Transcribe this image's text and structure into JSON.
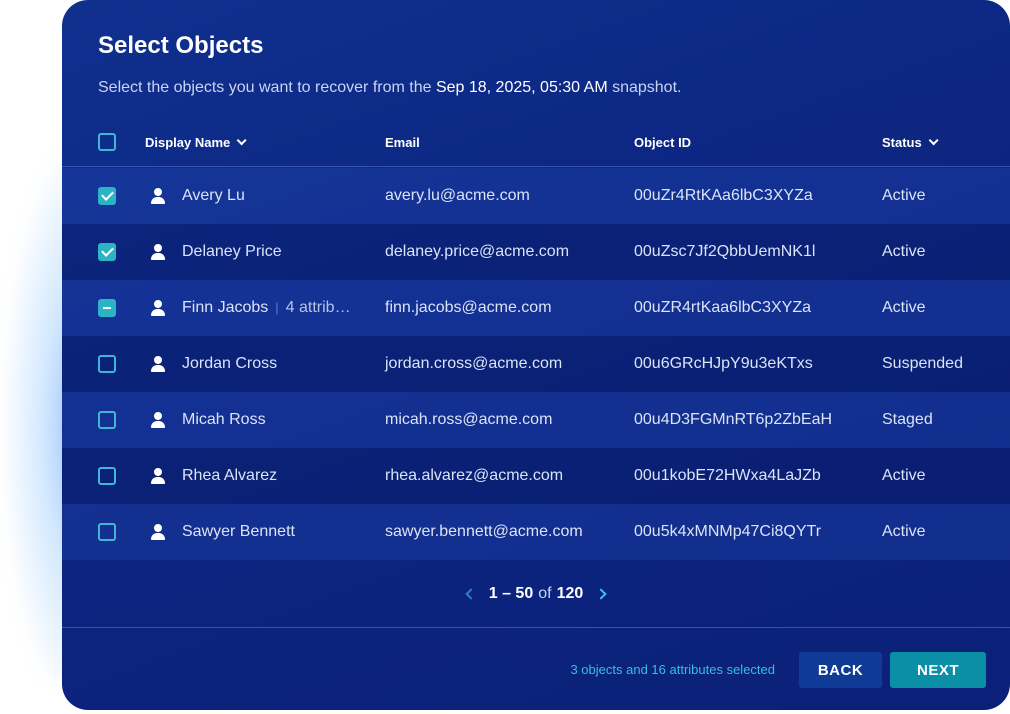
{
  "dialog": {
    "title": "Select Objects",
    "subtitle_prefix": "Select the objects you want to recover from the ",
    "subtitle_date": "Sep 18, 2025, 05:30 AM",
    "subtitle_suffix": " snapshot."
  },
  "columns": {
    "display_name": "Display Name",
    "email": "Email",
    "object_id": "Object ID",
    "status": "Status"
  },
  "rows": [
    {
      "name": "Avery Lu",
      "attrs": "",
      "email": "avery.lu@acme.com",
      "object_id": "00uZr4RtKAa6lbC3XYZa",
      "status": "Active",
      "selection": "checked"
    },
    {
      "name": "Delaney Price",
      "attrs": "",
      "email": "delaney.price@acme.com",
      "object_id": "00uZsc7Jf2QbbUemNK1l",
      "status": "Active",
      "selection": "checked"
    },
    {
      "name": "Finn Jacobs",
      "attrs": "4 attrib…",
      "email": "finn.jacobs@acme.com",
      "object_id": "00uZR4rtKaa6lbC3XYZa",
      "status": "Active",
      "selection": "partial"
    },
    {
      "name": "Jordan Cross",
      "attrs": "",
      "email": "jordan.cross@acme.com",
      "object_id": "00u6GRcHJpY9u3eKTxs",
      "status": "Suspended",
      "selection": "none"
    },
    {
      "name": "Micah Ross",
      "attrs": "",
      "email": "micah.ross@acme.com",
      "object_id": "00u4D3FGMnRT6p2ZbEaH",
      "status": "Staged",
      "selection": "none"
    },
    {
      "name": "Rhea Alvarez",
      "attrs": "",
      "email": "rhea.alvarez@acme.com",
      "object_id": "00u1kobE72HWxa4LaJZb",
      "status": "Active",
      "selection": "none"
    },
    {
      "name": "Sawyer Bennett",
      "attrs": "",
      "email": "sawyer.bennett@acme.com",
      "object_id": "00u5k4xMNMp47Ci8QYTr",
      "status": "Active",
      "selection": "none"
    }
  ],
  "pagination": {
    "range": "1 – 50",
    "of": "of",
    "total": "120"
  },
  "footer": {
    "selection_summary": "3 objects and 16 attributes selected",
    "back_label": "BACK",
    "next_label": "NEXT"
  },
  "colors": {
    "accent": "#2bb4c6",
    "panel_bg": "#0c2682",
    "next_button": "#0b8fa6"
  }
}
